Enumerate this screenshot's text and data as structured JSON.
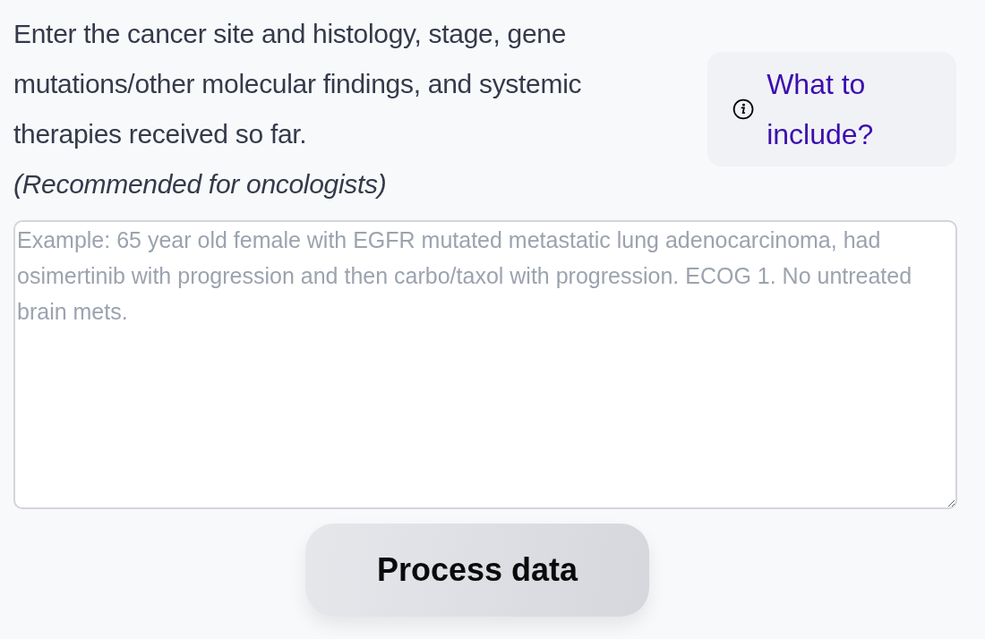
{
  "instructions": "Enter the cancer site and histology, stage, gene mutations/other molecular findings, and systemic therapies received so far.",
  "note": "(Recommended for oncologists)",
  "help_link": {
    "label": "What to include?"
  },
  "input": {
    "placeholder": "Example: 65 year old female with EGFR mutated metastatic lung adenocarcinoma, had osimertinib with progression and then carbo/taxol with progression. ECOG 1. No untreated brain mets."
  },
  "submit_button": {
    "label": "Process data"
  }
}
